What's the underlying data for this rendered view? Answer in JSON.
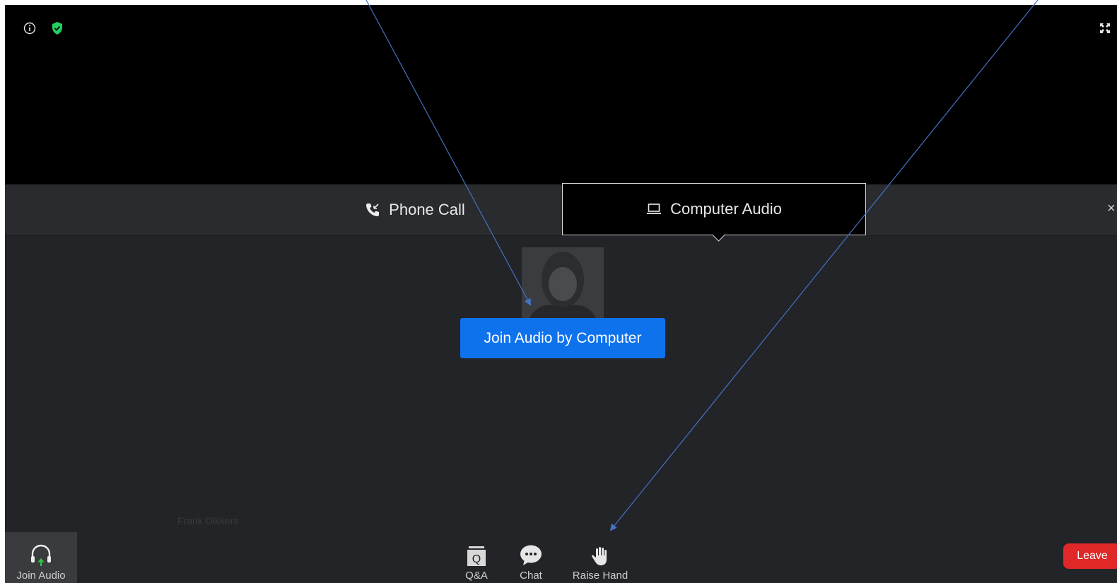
{
  "tabs": {
    "phone_call": "Phone Call",
    "computer_audio": "Computer Audio",
    "close": "×"
  },
  "main": {
    "join_button": "Join Audio by Computer",
    "participant_name": "Frank Dikkers"
  },
  "toolbar": {
    "join_audio": "Join Audio",
    "qa": "Q&A",
    "chat": "Chat",
    "raise_hand": "Raise Hand",
    "leave": "Leave"
  },
  "icons": {
    "info": "info-icon",
    "security": "shield-check-icon",
    "fullscreen": "fullscreen-icon",
    "phone": "phone-icon",
    "laptop": "laptop-icon",
    "headphones": "headphones-icon",
    "qa": "qa-icon",
    "chat": "chat-icon",
    "raise_hand": "raise-hand-icon"
  },
  "colors": {
    "primary_blue": "#0e72ed",
    "leave_red": "#e02828",
    "shield_green": "#23d160",
    "annotation_arrow": "#4472c4"
  }
}
